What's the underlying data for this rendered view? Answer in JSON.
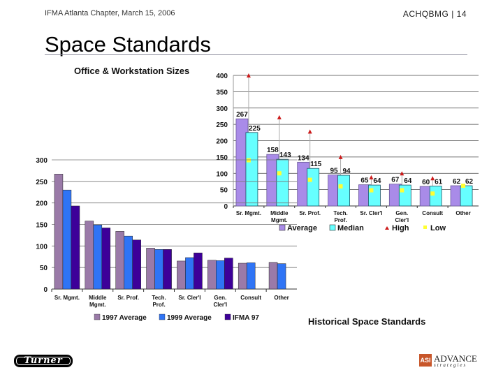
{
  "header": {
    "left": "IFMA Atlanta Chapter, March 15, 2006",
    "right": "ACHQBMG | 14"
  },
  "slide": {
    "title": "Space Standards",
    "subtitle": "Office & Workstation Sizes",
    "caption": "Historical Space Standards"
  },
  "logos": {
    "left": "Turner",
    "right_main": "ADVANCE",
    "right_sub": "strategies",
    "right_mark": "ASI"
  },
  "colors": {
    "average": "#a98be8",
    "median": "#66ffff",
    "high": "#cc1a1a",
    "low": "#ffff33",
    "y1997": "#9a7aa8",
    "y1999": "#2f74f5",
    "ifma97": "#3d0099"
  },
  "chart_data": [
    {
      "type": "bar",
      "title": "Office & Workstation Sizes",
      "categories": [
        "Sr. Mgmt.",
        "Middle Mgmt.",
        "Sr. Prof.",
        "Tech. Prof.",
        "Sr. Cler'l",
        "Gen. Cler'l",
        "Consult",
        "Other"
      ],
      "category_lines": [
        [
          "Sr. Mgmt."
        ],
        [
          "Middle",
          "Mgmt."
        ],
        [
          "Sr. Prof."
        ],
        [
          "Tech.",
          "Prof."
        ],
        [
          "Sr. Cler'l"
        ],
        [
          "Gen.",
          "Cler'l"
        ],
        [
          "Consult"
        ],
        [
          "Other"
        ]
      ],
      "series": [
        {
          "name": "Average",
          "kind": "bar",
          "values": [
            267,
            158,
            134,
            95,
            65,
            67,
            60,
            62
          ],
          "labels": [
            "267",
            "158",
            "134",
            "95",
            "65",
            "67",
            "60",
            "62"
          ]
        },
        {
          "name": "Median",
          "kind": "bar",
          "values": [
            225,
            143,
            115,
            94,
            64,
            64,
            61,
            62
          ],
          "labels": [
            "225",
            "143",
            "115",
            "94",
            "64",
            "64",
            "61",
            "62"
          ]
        },
        {
          "name": "High",
          "kind": "marker",
          "values": [
            400,
            272,
            228,
            150,
            88,
            100,
            85,
            null
          ]
        },
        {
          "name": "Low",
          "kind": "marker",
          "values": [
            140,
            100,
            80,
            60,
            48,
            48,
            38,
            62
          ]
        }
      ],
      "ylim": [
        0,
        400
      ],
      "yticks": [
        0,
        50,
        100,
        150,
        200,
        250,
        300,
        350,
        400
      ],
      "grid": true,
      "legend": "bottom"
    },
    {
      "type": "bar",
      "title": "Historical Space Standards",
      "categories": [
        "Sr. Mgmt.",
        "Middle Mgmt.",
        "Sr. Prof.",
        "Tech. Prof.",
        "Sr. Cler'l",
        "Gen. Cler'l",
        "Consult",
        "Other"
      ],
      "category_lines": [
        [
          "Sr. Mgmt."
        ],
        [
          "Middle",
          "Mgmt."
        ],
        [
          "Sr. Prof."
        ],
        [
          "Tech.",
          "Prof."
        ],
        [
          "Sr. Cler'l"
        ],
        [
          "Gen.",
          "Cler'l"
        ],
        [
          "Consult"
        ],
        [
          "Other"
        ]
      ],
      "series": [
        {
          "name": "1997 Average",
          "values": [
            267,
            158,
            134,
            95,
            65,
            67,
            60,
            62
          ]
        },
        {
          "name": "1999 Average",
          "values": [
            230,
            149,
            123,
            92,
            73,
            66,
            61,
            59
          ]
        },
        {
          "name": "IFMA 97",
          "values": [
            193,
            142,
            114,
            92,
            84,
            72,
            null,
            null
          ]
        }
      ],
      "ylim": [
        0,
        300
      ],
      "yticks": [
        0,
        50,
        100,
        150,
        200,
        250,
        300
      ],
      "grid": true,
      "legend": "bottom"
    }
  ]
}
